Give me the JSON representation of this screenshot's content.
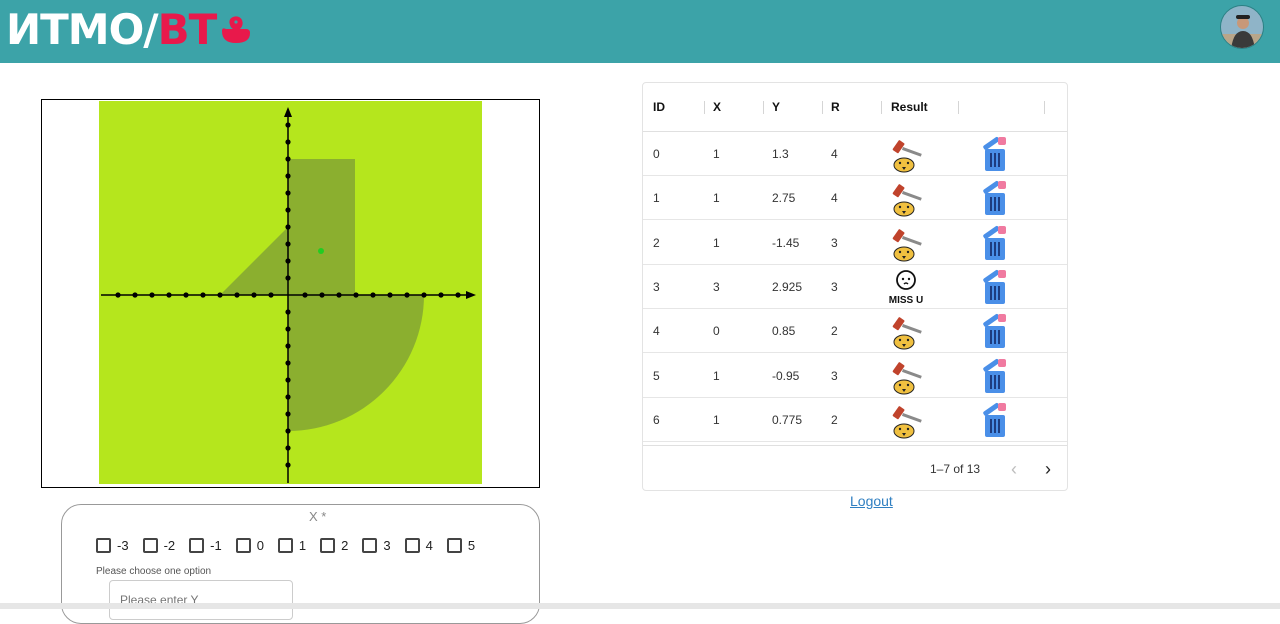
{
  "header": {
    "logo_main": "ИТМО/",
    "logo_accent": "ВТ",
    "logo_alt": "ITMO/BT",
    "colors": {
      "bar": "#3ca3a8",
      "accent": "#e8194b"
    },
    "avatar_icon": "user-avatar"
  },
  "graph": {
    "type": "area-plot",
    "background_color": "#b5e61d",
    "area_color": "#8baf2f",
    "point_color": "#22cc22",
    "regions": [
      "rectangle-top-right",
      "triangle-top-left",
      "quarter-circle-bottom-right"
    ]
  },
  "table": {
    "columns": [
      "ID",
      "X",
      "Y",
      "R",
      "Result",
      ""
    ],
    "rows": [
      {
        "id": "0",
        "x": "1",
        "y": "1.3",
        "r": "4",
        "result": "hit"
      },
      {
        "id": "1",
        "x": "1",
        "y": "2.75",
        "r": "4",
        "result": "hit"
      },
      {
        "id": "2",
        "x": "1",
        "y": "-1.45",
        "r": "3",
        "result": "hit"
      },
      {
        "id": "3",
        "x": "3",
        "y": "2.925",
        "r": "3",
        "result": "miss"
      },
      {
        "id": "4",
        "x": "0",
        "y": "0.85",
        "r": "2",
        "result": "hit"
      },
      {
        "id": "5",
        "x": "1",
        "y": "-0.95",
        "r": "3",
        "result": "hit"
      },
      {
        "id": "6",
        "x": "1",
        "y": "0.775",
        "r": "2",
        "result": "hit"
      }
    ],
    "icons": {
      "hit": "gavel-hamster-icon",
      "miss": "miss-u-icon",
      "delete": "trash-icon"
    },
    "miss_label": "MISS U",
    "pagination": {
      "text": "1–7 of 13",
      "prev": "‹",
      "next": "›"
    }
  },
  "logout": "Logout",
  "form": {
    "x_label": "X *",
    "x_options": [
      "-3",
      "-2",
      "-1",
      "0",
      "1",
      "2",
      "3",
      "4",
      "5"
    ],
    "hint": "Please choose one option",
    "y_placeholder": "Please enter Y"
  }
}
